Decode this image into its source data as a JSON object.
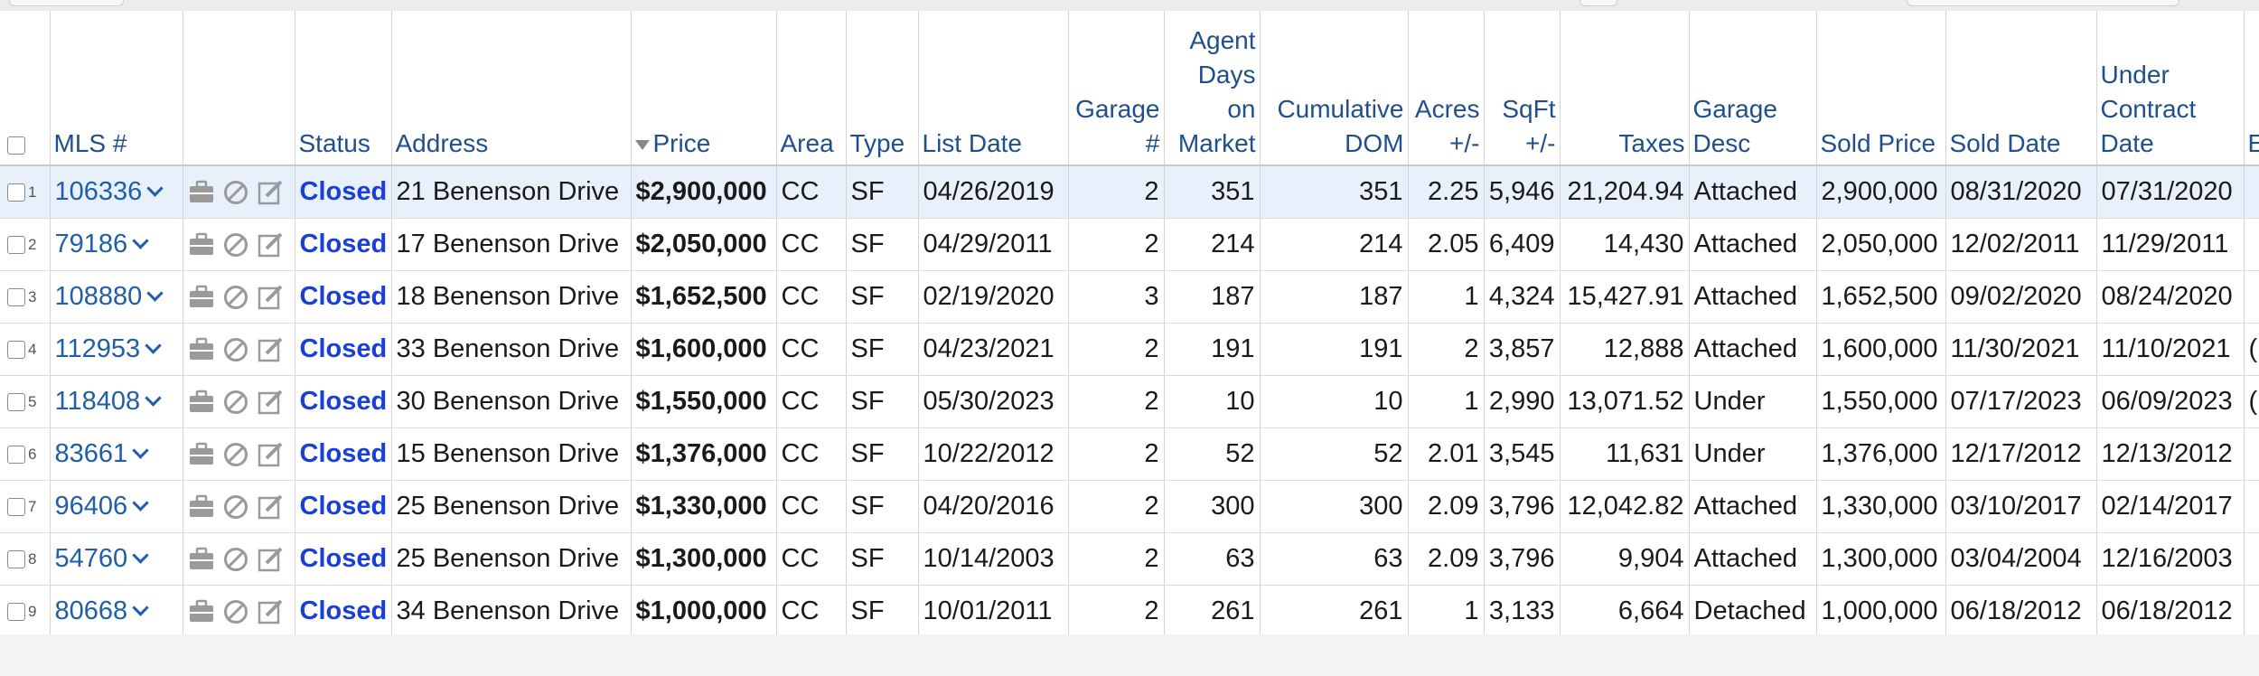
{
  "columns": {
    "mls": "MLS #",
    "status": "Status",
    "address": "Address",
    "price": "Price",
    "area": "Area",
    "type": "Type",
    "list_date": "List Date",
    "garage_num": "Garage #",
    "agent_dom": "Agent Days on Market",
    "cumulative_dom": "Cumulative DOM",
    "acres": "Acres +/-",
    "sqft": "SqFt +/-",
    "taxes": "Taxes",
    "garage_desc": "Garage Desc",
    "sold_price": "Sold Price",
    "sold_date": "Sold Date",
    "under_contract": "Under Contract Date",
    "extra": "E Z"
  },
  "sort": {
    "column": "price",
    "direction": "descending"
  },
  "rows": [
    {
      "n": "1",
      "mls": "106336",
      "status": "Closed",
      "address": "21 Benenson Drive",
      "price": "$2,900,000",
      "area": "CC",
      "type": "SF",
      "list_date": "04/26/2019",
      "garage": "2",
      "adom": "351",
      "cdom": "351",
      "acres": "2.25",
      "sqft": "5,946",
      "taxes": "21,204.94",
      "gdesc": "Attached",
      "sold_price": "2,900,000",
      "sold_date": "08/31/2020",
      "ucd": "07/31/2020",
      "extra": ""
    },
    {
      "n": "2",
      "mls": "79186",
      "status": "Closed",
      "address": "17 Benenson Drive",
      "price": "$2,050,000",
      "area": "CC",
      "type": "SF",
      "list_date": "04/29/2011",
      "garage": "2",
      "adom": "214",
      "cdom": "214",
      "acres": "2.05",
      "sqft": "6,409",
      "taxes": "14,430",
      "gdesc": "Attached",
      "sold_price": "2,050,000",
      "sold_date": "12/02/2011",
      "ucd": "11/29/2011",
      "extra": ""
    },
    {
      "n": "3",
      "mls": "108880",
      "status": "Closed",
      "address": "18 Benenson Drive",
      "price": "$1,652,500",
      "area": "CC",
      "type": "SF",
      "list_date": "02/19/2020",
      "garage": "3",
      "adom": "187",
      "cdom": "187",
      "acres": "1",
      "sqft": "4,324",
      "taxes": "15,427.91",
      "gdesc": "Attached",
      "sold_price": "1,652,500",
      "sold_date": "09/02/2020",
      "ucd": "08/24/2020",
      "extra": ""
    },
    {
      "n": "4",
      "mls": "112953",
      "status": "Closed",
      "address": "33 Benenson Drive",
      "price": "$1,600,000",
      "area": "CC",
      "type": "SF",
      "list_date": "04/23/2021",
      "garage": "2",
      "adom": "191",
      "cdom": "191",
      "acres": "2",
      "sqft": "3,857",
      "taxes": "12,888",
      "gdesc": "Attached",
      "sold_price": "1,600,000",
      "sold_date": "11/30/2021",
      "ucd": "11/10/2021",
      "extra": "("
    },
    {
      "n": "5",
      "mls": "118408",
      "status": "Closed",
      "address": "30 Benenson Drive",
      "price": "$1,550,000",
      "area": "CC",
      "type": "SF",
      "list_date": "05/30/2023",
      "garage": "2",
      "adom": "10",
      "cdom": "10",
      "acres": "1",
      "sqft": "2,990",
      "taxes": "13,071.52",
      "gdesc": "Under",
      "sold_price": "1,550,000",
      "sold_date": "07/17/2023",
      "ucd": "06/09/2023",
      "extra": "("
    },
    {
      "n": "6",
      "mls": "83661",
      "status": "Closed",
      "address": "15 Benenson Drive",
      "price": "$1,376,000",
      "area": "CC",
      "type": "SF",
      "list_date": "10/22/2012",
      "garage": "2",
      "adom": "52",
      "cdom": "52",
      "acres": "2.01",
      "sqft": "3,545",
      "taxes": "11,631",
      "gdesc": "Under",
      "sold_price": "1,376,000",
      "sold_date": "12/17/2012",
      "ucd": "12/13/2012",
      "extra": ""
    },
    {
      "n": "7",
      "mls": "96406",
      "status": "Closed",
      "address": "25 Benenson Drive",
      "price": "$1,330,000",
      "area": "CC",
      "type": "SF",
      "list_date": "04/20/2016",
      "garage": "2",
      "adom": "300",
      "cdom": "300",
      "acres": "2.09",
      "sqft": "3,796",
      "taxes": "12,042.82",
      "gdesc": "Attached",
      "sold_price": "1,330,000",
      "sold_date": "03/10/2017",
      "ucd": "02/14/2017",
      "extra": ""
    },
    {
      "n": "8",
      "mls": "54760",
      "status": "Closed",
      "address": "25 Benenson Drive",
      "price": "$1,300,000",
      "area": "CC",
      "type": "SF",
      "list_date": "10/14/2003",
      "garage": "2",
      "adom": "63",
      "cdom": "63",
      "acres": "2.09",
      "sqft": "3,796",
      "taxes": "9,904",
      "gdesc": "Attached",
      "sold_price": "1,300,000",
      "sold_date": "03/04/2004",
      "ucd": "12/16/2003",
      "extra": ""
    },
    {
      "n": "9",
      "mls": "80668",
      "status": "Closed",
      "address": "34 Benenson Drive",
      "price": "$1,000,000",
      "area": "CC",
      "type": "SF",
      "list_date": "10/01/2011",
      "garage": "2",
      "adom": "261",
      "cdom": "261",
      "acres": "1",
      "sqft": "3,133",
      "taxes": "6,664",
      "gdesc": "Detached",
      "sold_price": "1,000,000",
      "sold_date": "06/18/2012",
      "ucd": "06/18/2012",
      "extra": ""
    }
  ],
  "colors": {
    "link": "#1f5ea8",
    "status": "#1a3fd6",
    "header": "#1f4f8c",
    "selected_row": "#e8f1fb"
  },
  "icons": [
    "briefcase-icon",
    "block-icon",
    "edit-icon",
    "chevron-down-icon"
  ]
}
